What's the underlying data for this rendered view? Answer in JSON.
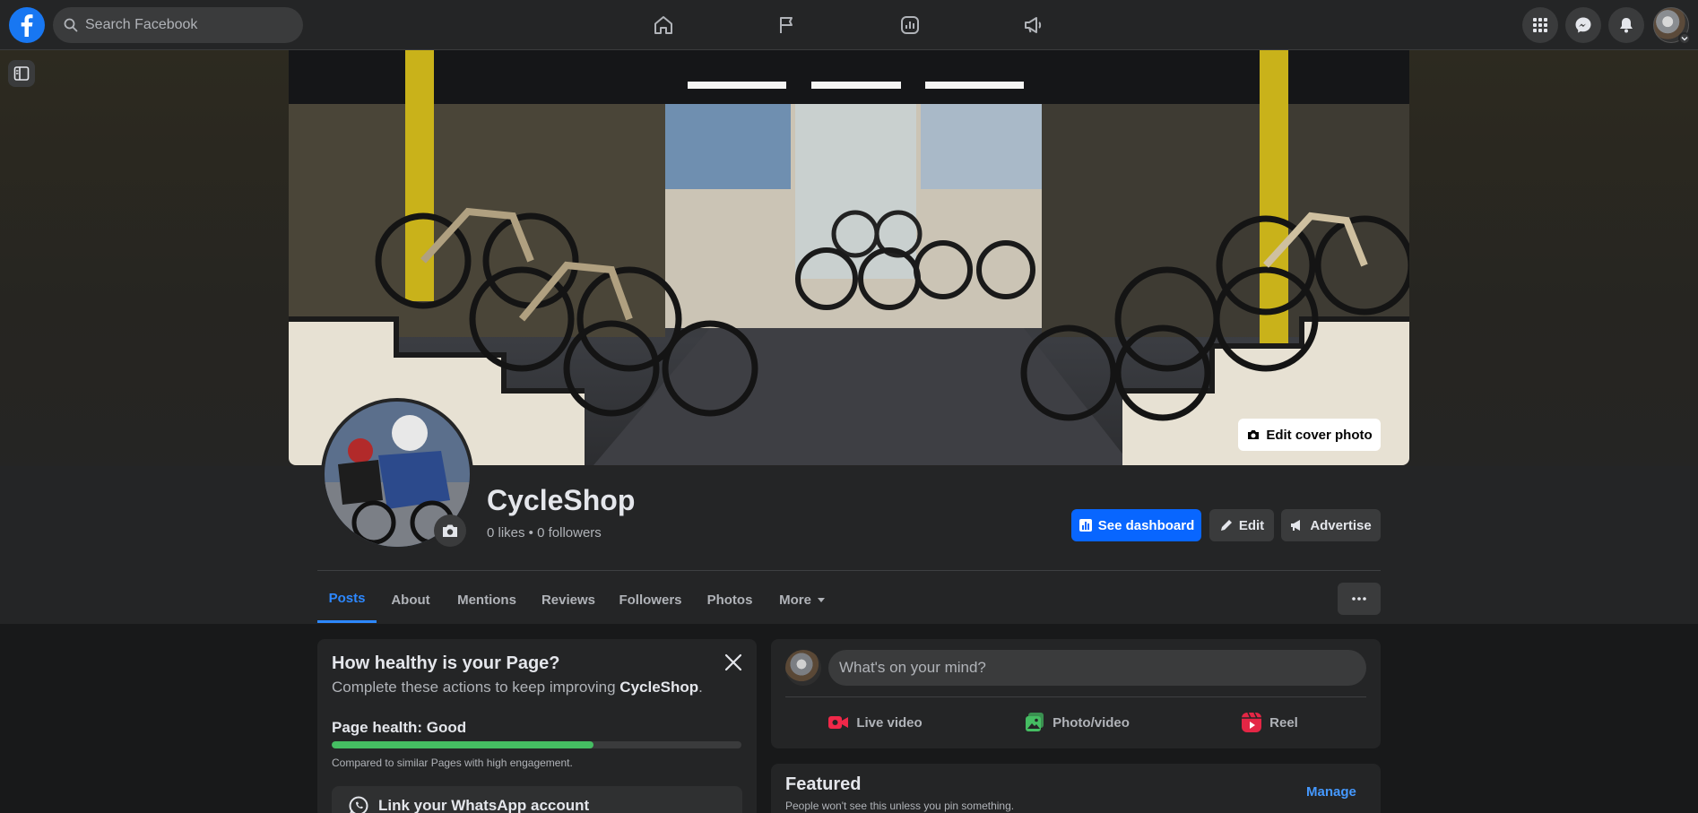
{
  "topbar": {
    "search_placeholder": "Search Facebook"
  },
  "cover": {
    "edit_label": "Edit cover photo"
  },
  "profile": {
    "name": "CycleShop",
    "stats": "0 likes • 0 followers"
  },
  "actions": {
    "dashboard": "See dashboard",
    "edit": "Edit",
    "advertise": "Advertise"
  },
  "tabs": [
    {
      "label": "Posts"
    },
    {
      "label": "About"
    },
    {
      "label": "Mentions"
    },
    {
      "label": "Reviews"
    },
    {
      "label": "Followers"
    },
    {
      "label": "Photos"
    },
    {
      "label": "More"
    }
  ],
  "health": {
    "title": "How healthy is your Page?",
    "subtitle_prefix": "Complete these actions to keep improving ",
    "subtitle_page": "CycleShop",
    "subtitle_suffix": ".",
    "label": "Page health: Good",
    "progress_fraction": 0.64,
    "note": "Compared to similar Pages with high engagement.",
    "whatsapp": "Link your WhatsApp account"
  },
  "composer": {
    "placeholder": "What's on your mind?",
    "live": "Live video",
    "photo": "Photo/video",
    "reel": "Reel"
  },
  "featured": {
    "title": "Featured",
    "subtitle": "People won't see this unless you pin something.",
    "manage": "Manage"
  },
  "colors": {
    "brand_blue": "#0866ff",
    "link_blue": "#2d88ff",
    "health_green": "#45bd62",
    "live_red": "#f02849",
    "photo_green": "#45bd62",
    "reel_pink": "#e42645"
  },
  "icons": {
    "logo": "facebook-logo-icon",
    "search": "search-icon",
    "home": "home-icon",
    "flag": "flag-icon",
    "insights": "insights-icon",
    "ads": "megaphone-icon",
    "menu": "grid-menu-icon",
    "messenger": "messenger-icon",
    "notifications": "bell-icon",
    "camera": "camera-icon",
    "more": "ellipsis-icon",
    "close": "close-icon",
    "whatsapp": "whatsapp-icon"
  }
}
